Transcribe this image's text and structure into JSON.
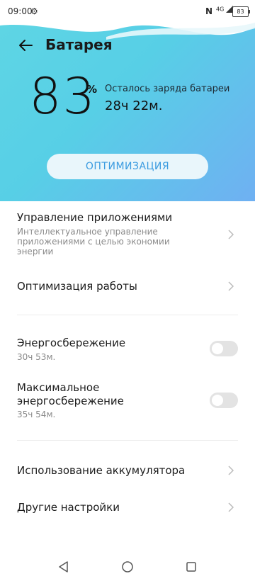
{
  "status": {
    "time": "09:00",
    "network": "4G",
    "battery": "83"
  },
  "header": {
    "title": "Батарея",
    "back_icon": "arrow-left-icon"
  },
  "battery": {
    "percent": "83",
    "percent_sign": "%",
    "remaining_label": "Осталось заряда батареи",
    "remaining_value": "28ч 22м."
  },
  "optimize_button": "ОПТИМИЗАЦИЯ",
  "items": {
    "app_management": {
      "title": "Управление приложениями",
      "subtitle": "Интеллектуальное управление приложениями с целью экономии энергии"
    },
    "work_optimization": {
      "title": "Оптимизация работы"
    },
    "power_saving": {
      "title": "Энергосбережение",
      "subtitle": "30ч 53м.",
      "enabled": false
    },
    "max_power_saving": {
      "title": "Максимальное энергосбережение",
      "subtitle": "35ч 54м.",
      "enabled": false
    },
    "battery_usage": {
      "title": "Использование аккумулятора"
    },
    "other_settings": {
      "title": "Другие настройки"
    }
  },
  "colors": {
    "accent": "#3a9be0",
    "hero_start": "#5fd6e4",
    "hero_end": "#6fb0f2"
  }
}
